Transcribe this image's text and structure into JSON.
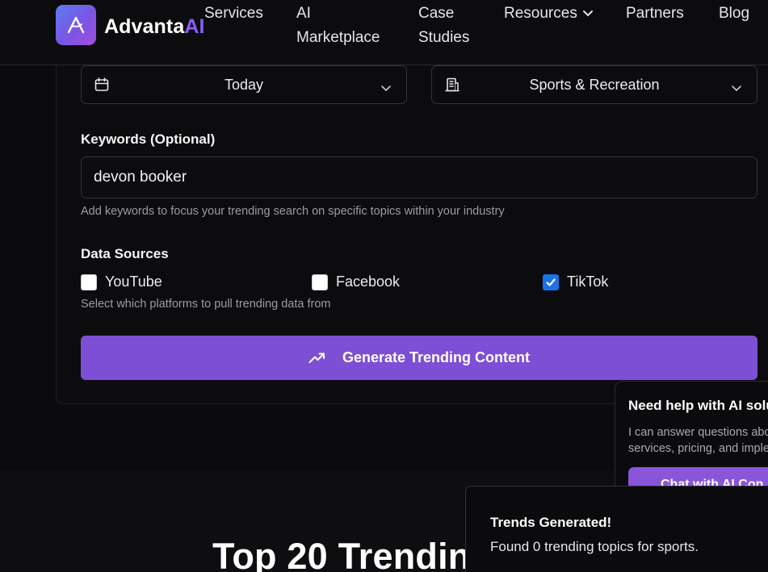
{
  "nav": {
    "brand_main": "Advanta",
    "brand_accent": "AI",
    "links": [
      {
        "label": "Services"
      },
      {
        "label": "AI\nMarketplace"
      },
      {
        "label": "Case\nStudies"
      },
      {
        "label": "Resources",
        "has_dropdown": true
      },
      {
        "label": "Partners"
      },
      {
        "label": "Blog"
      }
    ]
  },
  "form": {
    "timeframe_select": {
      "value": "Today",
      "icon": "calendar-icon"
    },
    "industry_select": {
      "value": "Sports & Recreation",
      "icon": "building-icon"
    },
    "keywords": {
      "label": "Keywords (Optional)",
      "value": "devon booker",
      "help": "Add keywords to focus your trending search on specific topics within your industry"
    },
    "data_sources": {
      "label": "Data Sources",
      "options": [
        {
          "label": "YouTube",
          "checked": false
        },
        {
          "label": "Facebook",
          "checked": false
        },
        {
          "label": "TikTok",
          "checked": true
        }
      ],
      "help": "Select which platforms to pull trending data from"
    },
    "generate_button": {
      "label": "Generate Trending Content",
      "icon": "trending-up-icon"
    }
  },
  "section": {
    "title": "Top 20 Trendinc"
  },
  "chat_popup": {
    "title": "Need help with AI solu",
    "body_line1": "I can answer questions abo",
    "body_line2": "services, pricing, and imple",
    "button_label": "Chat with AI Con"
  },
  "toast": {
    "title": "Trends Generated!",
    "message": "Found 0 trending topics for sports."
  },
  "colors": {
    "background": "#0b0b0d",
    "accent": "#7d4fd4",
    "brand_accent": "#8b5cf6",
    "checkbox_on": "#1a73e8"
  }
}
